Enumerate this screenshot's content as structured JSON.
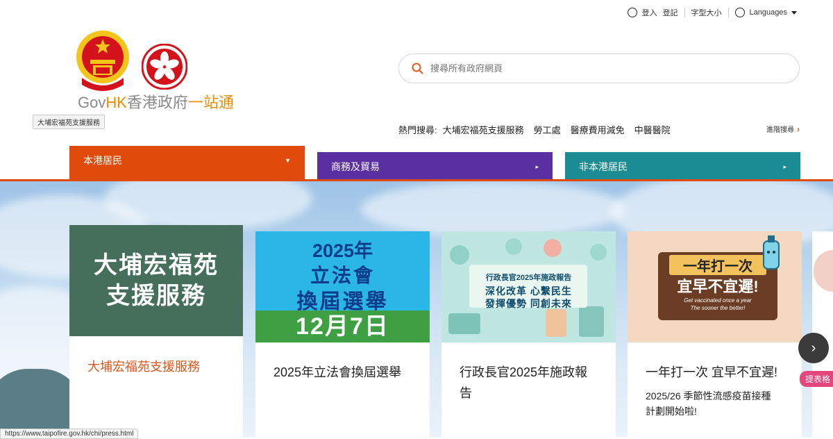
{
  "topbar": {
    "login": "登入",
    "register": "登記",
    "font_size": "字型大小",
    "languages": "Languages"
  },
  "logo": {
    "gov": "Gov",
    "hk": "HK",
    "cn_gov": "香港政府",
    "cn_onestop": "一站通"
  },
  "tooltip": "大埔宏福苑支援服務",
  "search": {
    "placeholder": "搜尋所有政府網頁",
    "hot_label": "熱門搜尋:",
    "hot_items": [
      "大埔宏福苑支援服務",
      "勞工處",
      "醫療費用減免",
      "中醫醫院"
    ],
    "advanced": "進階搜尋"
  },
  "tabs": [
    {
      "label": "本港居民",
      "color": "#e04b0b"
    },
    {
      "label": "商務及貿易",
      "color": "#5a2fa0"
    },
    {
      "label": "非本港居民",
      "color": "#1b8c93"
    }
  ],
  "cards": [
    {
      "image_text": "大埔宏福苑支援服務",
      "title": "大埔宏福苑支援服務"
    },
    {
      "image_lines": [
        "2025年",
        "立法會",
        "換屆選舉",
        "12月7日"
      ],
      "title": "2025年立法會換屆選舉"
    },
    {
      "image_lines": [
        "行政長官2025年施政報告",
        "深化改革 心繫民生",
        "發揮優勢 同創未來"
      ],
      "title": "行政長官2025年施政報告"
    },
    {
      "image_lines": [
        "一年打一次",
        "宜早不宜遲!",
        "Get vaccinated once a year",
        "The sooner the better!"
      ],
      "title": "一年打一次 宜早不宜遲!",
      "description": "2025/26 季節性流感疫苗接種計劃開始啦!"
    }
  ],
  "feedback": "提表格",
  "status_url": "https://www.taipofire.gov.hk/chi/press.html",
  "colors": {
    "accent": "#e04b0b",
    "brand_orange": "#f08a00"
  }
}
